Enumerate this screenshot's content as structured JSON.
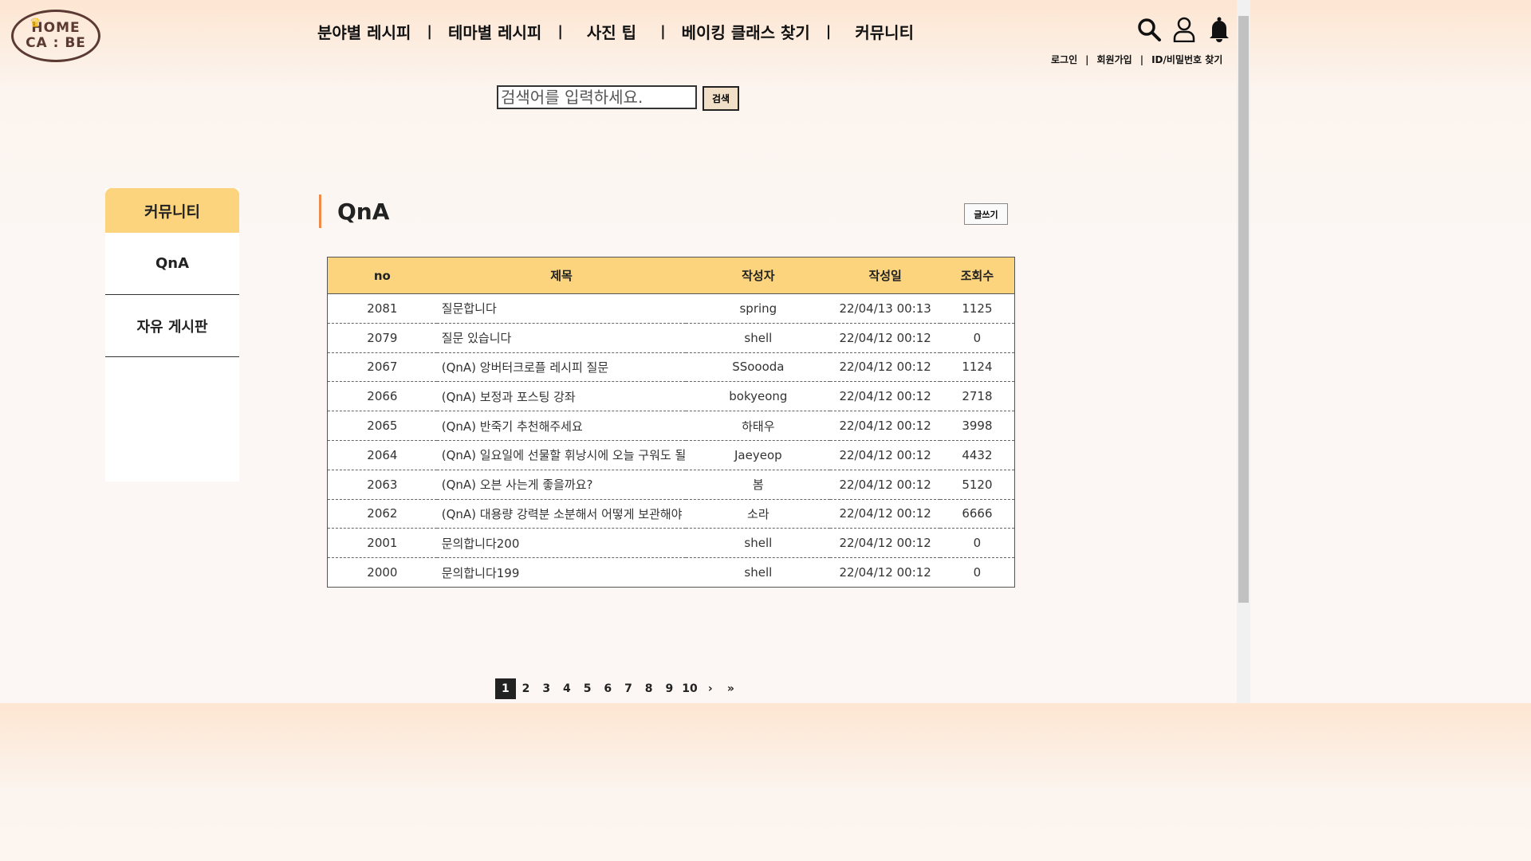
{
  "logo": {
    "line1": "HOME",
    "line2": "CA : BE"
  },
  "nav": {
    "items": [
      "분야별 레시피",
      "테마별 레시피",
      "사진 팁",
      "베이킹 클래스 찾기",
      "커뮤니티"
    ],
    "separator": "|"
  },
  "header_icons": [
    "search-icon",
    "user-icon",
    "bell-icon"
  ],
  "util": {
    "login": "로그인",
    "signup": "회원가입",
    "find": "ID/비밀번호 찾기",
    "separator": "|"
  },
  "search": {
    "placeholder": "검색어를 입력하세요.",
    "button": "검색"
  },
  "sidebar": {
    "title": "커뮤니티",
    "items": [
      "QnA",
      "자유 게시판"
    ]
  },
  "board": {
    "title": "QnA",
    "write_button": "글쓰기",
    "columns": [
      "no",
      "제목",
      "작성자",
      "작성일",
      "조회수"
    ],
    "rows": [
      {
        "no": "2081",
        "title": "질문합니다",
        "author": "spring",
        "date": "22/04/13 00:13",
        "views": "1125"
      },
      {
        "no": "2079",
        "title": "질문 있습니다",
        "author": "shell",
        "date": "22/04/12 00:12",
        "views": "0"
      },
      {
        "no": "2067",
        "title": "(QnA) 앙버터크로플 레시피 질문",
        "author": "SSoooda",
        "date": "22/04/12 00:12",
        "views": "1124"
      },
      {
        "no": "2066",
        "title": "(QnA) 보정과 포스팅 강좌",
        "author": "bokyeong",
        "date": "22/04/12 00:12",
        "views": "2718"
      },
      {
        "no": "2065",
        "title": "(QnA) 반죽기 추천해주세요",
        "author": "하태우",
        "date": "22/04/12 00:12",
        "views": "3998"
      },
      {
        "no": "2064",
        "title": "(QnA) 일요일에 선물할 휘낭시에 오늘 구워도 될",
        "author": "Jaeyeop",
        "date": "22/04/12 00:12",
        "views": "4432"
      },
      {
        "no": "2063",
        "title": "(QnA) 오븐 사는게 좋을까요?",
        "author": "봄",
        "date": "22/04/12 00:12",
        "views": "5120"
      },
      {
        "no": "2062",
        "title": "(QnA) 대용량 강력분 소분해서 어떻게 보관해야",
        "author": "소라",
        "date": "22/04/12 00:12",
        "views": "6666"
      },
      {
        "no": "2001",
        "title": "문의합니다200",
        "author": "shell",
        "date": "22/04/12 00:12",
        "views": "0"
      },
      {
        "no": "2000",
        "title": "문의합니다199",
        "author": "shell",
        "date": "22/04/12 00:12",
        "views": "0"
      }
    ]
  },
  "pagination": {
    "pages": [
      "1",
      "2",
      "3",
      "4",
      "5",
      "6",
      "7",
      "8",
      "9",
      "10"
    ],
    "current": "1",
    "next": "›",
    "last": "»"
  },
  "colors": {
    "accent": "#fcd47e",
    "title_bar": "#f08a4b",
    "logo": "#5b3a34"
  }
}
